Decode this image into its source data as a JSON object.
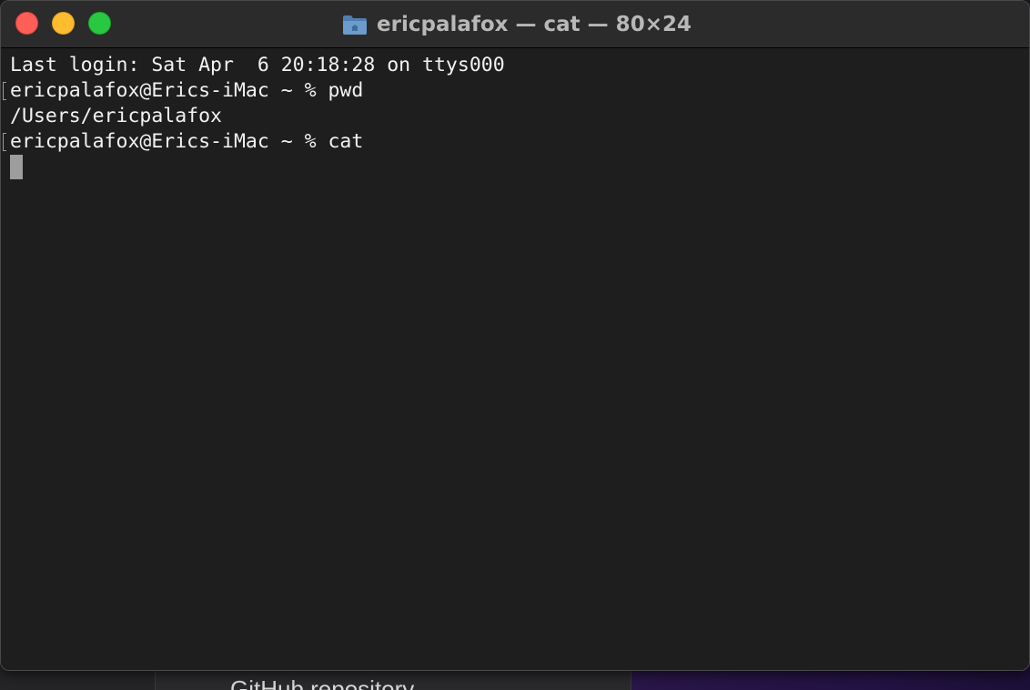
{
  "window": {
    "title": "ericpalafox — cat — 80×24",
    "title_icon": "folder-icon",
    "traffic_lights": {
      "close_color": "#ff5f57",
      "minimize_color": "#febc2e",
      "zoom_color": "#28c840"
    }
  },
  "terminal": {
    "lines": [
      "Last login: Sat Apr  6 20:18:28 on ttys000",
      "ericpalafox@Erics-iMac ~ % pwd",
      "/Users/ericpalafox",
      "ericpalafox@Erics-iMac ~ % cat"
    ],
    "colors": {
      "background": "#1e1e1e",
      "text": "#f2f2f2",
      "cursor": "#9d9d9d"
    }
  },
  "background_window": {
    "partial_text": "GitHub repository"
  }
}
